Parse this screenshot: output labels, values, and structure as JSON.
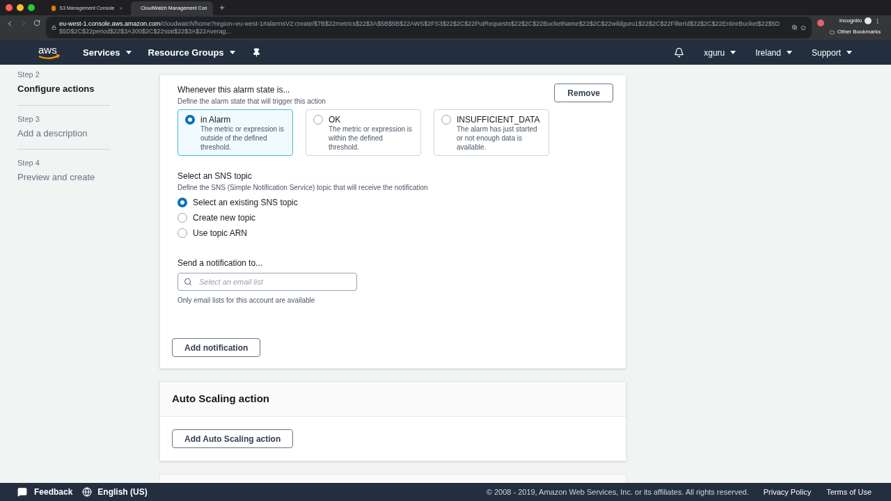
{
  "browser": {
    "tabs": [
      {
        "title": "S3 Management Console",
        "selected": false
      },
      {
        "title": "CloudWatch Management Con",
        "selected": true
      }
    ],
    "url_host": "eu-west-1.console.aws.amazon.com",
    "url_path": "/cloudwatch/home?region=eu-west-1#alarmsV2:create/$7B$22metrics$22$3A$5B$5B$22AWS$2FS3$22$2C$22PutRequests$22$2C$22BucketName$22$2C$22wildguru1$22$2C$22FilterId$22$2C$22EntireBucket$22$5D$5D$2C$22period$22$3A300$2C$22stat$22$3A$22Averag...",
    "profile": "Incognito",
    "bookmarks": "Other Bookmarks"
  },
  "nav": {
    "logo": "aws",
    "services": "Services",
    "resource_groups": "Resource Groups",
    "user": "xguru",
    "region": "Ireland",
    "support": "Support"
  },
  "steps": [
    {
      "step": "Step 2",
      "title": "Configure actions",
      "selected": true
    },
    {
      "step": "Step 3",
      "title": "Add a description",
      "selected": false
    },
    {
      "step": "Step 4",
      "title": "Preview and create",
      "selected": false
    }
  ],
  "notification": {
    "state_label": "Whenever this alarm state is...",
    "state_hint": "Define the alarm state that will trigger this action",
    "remove": "Remove",
    "states": [
      {
        "title": "in Alarm",
        "description": "The metric or expression is outside of the defined threshold.",
        "selected": true
      },
      {
        "title": "OK",
        "description": "The metric or expression is within the defined threshold.",
        "selected": false
      },
      {
        "title": "INSUFFICIENT_DATA",
        "description": "The alarm has just started or not enough data is available.",
        "selected": false
      }
    ],
    "sns_label": "Select an SNS topic",
    "sns_hint": "Define the SNS (Simple Notification Service) topic that will receive the notification",
    "sns_options": [
      {
        "label": "Select an existing SNS topic",
        "selected": true
      },
      {
        "label": "Create new topic",
        "selected": false
      },
      {
        "label": "Use topic ARN",
        "selected": false
      }
    ],
    "send_label": "Send a notification to...",
    "send_placeholder": "Select an email list",
    "send_hint": "Only email lists for this account are available",
    "add": "Add notification"
  },
  "auto_scaling": {
    "title": "Auto Scaling action",
    "button": "Add Auto Scaling action"
  },
  "footer": {
    "feedback": "Feedback",
    "language": "English (US)",
    "copyright": "© 2008 - 2019, Amazon Web Services, Inc. or its affiliates. All rights reserved.",
    "privacy": "Privacy Policy",
    "terms": "Terms of Use"
  }
}
